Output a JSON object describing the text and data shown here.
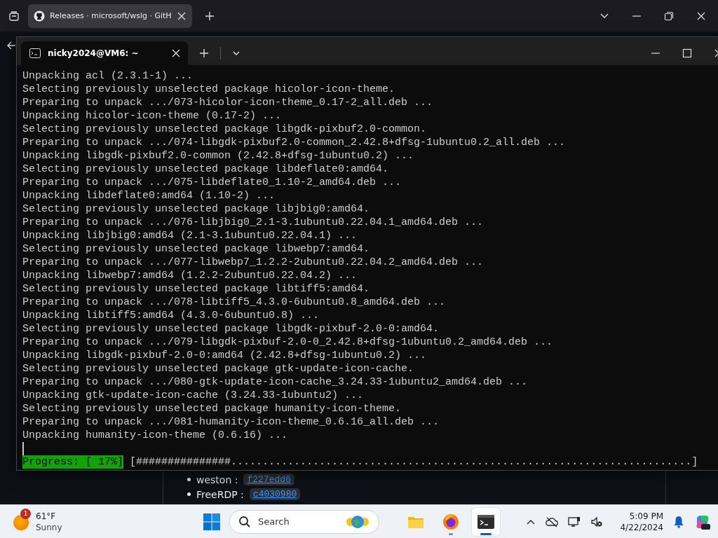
{
  "browser": {
    "tabs": [
      {
        "title": "Releases · microsoft/wslg · GitH",
        "selected": true
      }
    ],
    "page": {
      "items": [
        {
          "label": "weston :",
          "commit": "f227edd6"
        },
        {
          "label": "FreeRDP :",
          "commit": "c4030980"
        }
      ]
    }
  },
  "terminal": {
    "tabs": [
      {
        "title": "nicky2024@VM6: ~",
        "selected": true
      }
    ],
    "lines": [
      "Unpacking acl (2.3.1-1) ...",
      "Selecting previously unselected package hicolor-icon-theme.",
      "Preparing to unpack .../073-hicolor-icon-theme_0.17-2_all.deb ...",
      "Unpacking hicolor-icon-theme (0.17-2) ...",
      "Selecting previously unselected package libgdk-pixbuf2.0-common.",
      "Preparing to unpack .../074-libgdk-pixbuf2.0-common_2.42.8+dfsg-1ubuntu0.2_all.deb ...",
      "Unpacking libgdk-pixbuf2.0-common (2.42.8+dfsg-1ubuntu0.2) ...",
      "Selecting previously unselected package libdeflate0:amd64.",
      "Preparing to unpack .../075-libdeflate0_1.10-2_amd64.deb ...",
      "Unpacking libdeflate0:amd64 (1.10-2) ...",
      "Selecting previously unselected package libjbig0:amd64.",
      "Preparing to unpack .../076-libjbig0_2.1-3.1ubuntu0.22.04.1_amd64.deb ...",
      "Unpacking libjbig0:amd64 (2.1-3.1ubuntu0.22.04.1) ...",
      "Selecting previously unselected package libwebp7:amd64.",
      "Preparing to unpack .../077-libwebp7_1.2.2-2ubuntu0.22.04.2_amd64.deb ...",
      "Unpacking libwebp7:amd64 (1.2.2-2ubuntu0.22.04.2) ...",
      "Selecting previously unselected package libtiff5:amd64.",
      "Preparing to unpack .../078-libtiff5_4.3.0-6ubuntu0.8_amd64.deb ...",
      "Unpacking libtiff5:amd64 (4.3.0-6ubuntu0.8) ...",
      "Selecting previously unselected package libgdk-pixbuf-2.0-0:amd64.",
      "Preparing to unpack .../079-libgdk-pixbuf-2.0-0_2.42.8+dfsg-1ubuntu0.2_amd64.deb ...",
      "Unpacking libgdk-pixbuf-2.0-0:amd64 (2.42.8+dfsg-1ubuntu0.2) ...",
      "Selecting previously unselected package gtk-update-icon-cache.",
      "Preparing to unpack .../080-gtk-update-icon-cache_3.24.33-1ubuntu2_amd64.deb ...",
      "Unpacking gtk-update-icon-cache (3.24.33-1ubuntu2) ...",
      "Selecting previously unselected package humanity-icon-theme.",
      "Preparing to unpack .../081-humanity-icon-theme_0.6.16_all.deb ...",
      "Unpacking humanity-icon-theme (0.6.16) ..."
    ],
    "progress": {
      "label": "Progress: [ 17%]",
      "bar": "[###############.........................................................................]"
    }
  },
  "taskbar": {
    "weather": {
      "badge": "1",
      "temperature": "61°F",
      "condition": "Sunny"
    },
    "search": {
      "label": "Search"
    },
    "apps": [
      {
        "kind": "explorer",
        "running": false,
        "active": false
      },
      {
        "kind": "firefox",
        "running": true,
        "active": false
      },
      {
        "kind": "terminal",
        "running": true,
        "active": true
      }
    ],
    "clock": {
      "time": "5:09 PM",
      "date": "4/22/2024"
    }
  }
}
